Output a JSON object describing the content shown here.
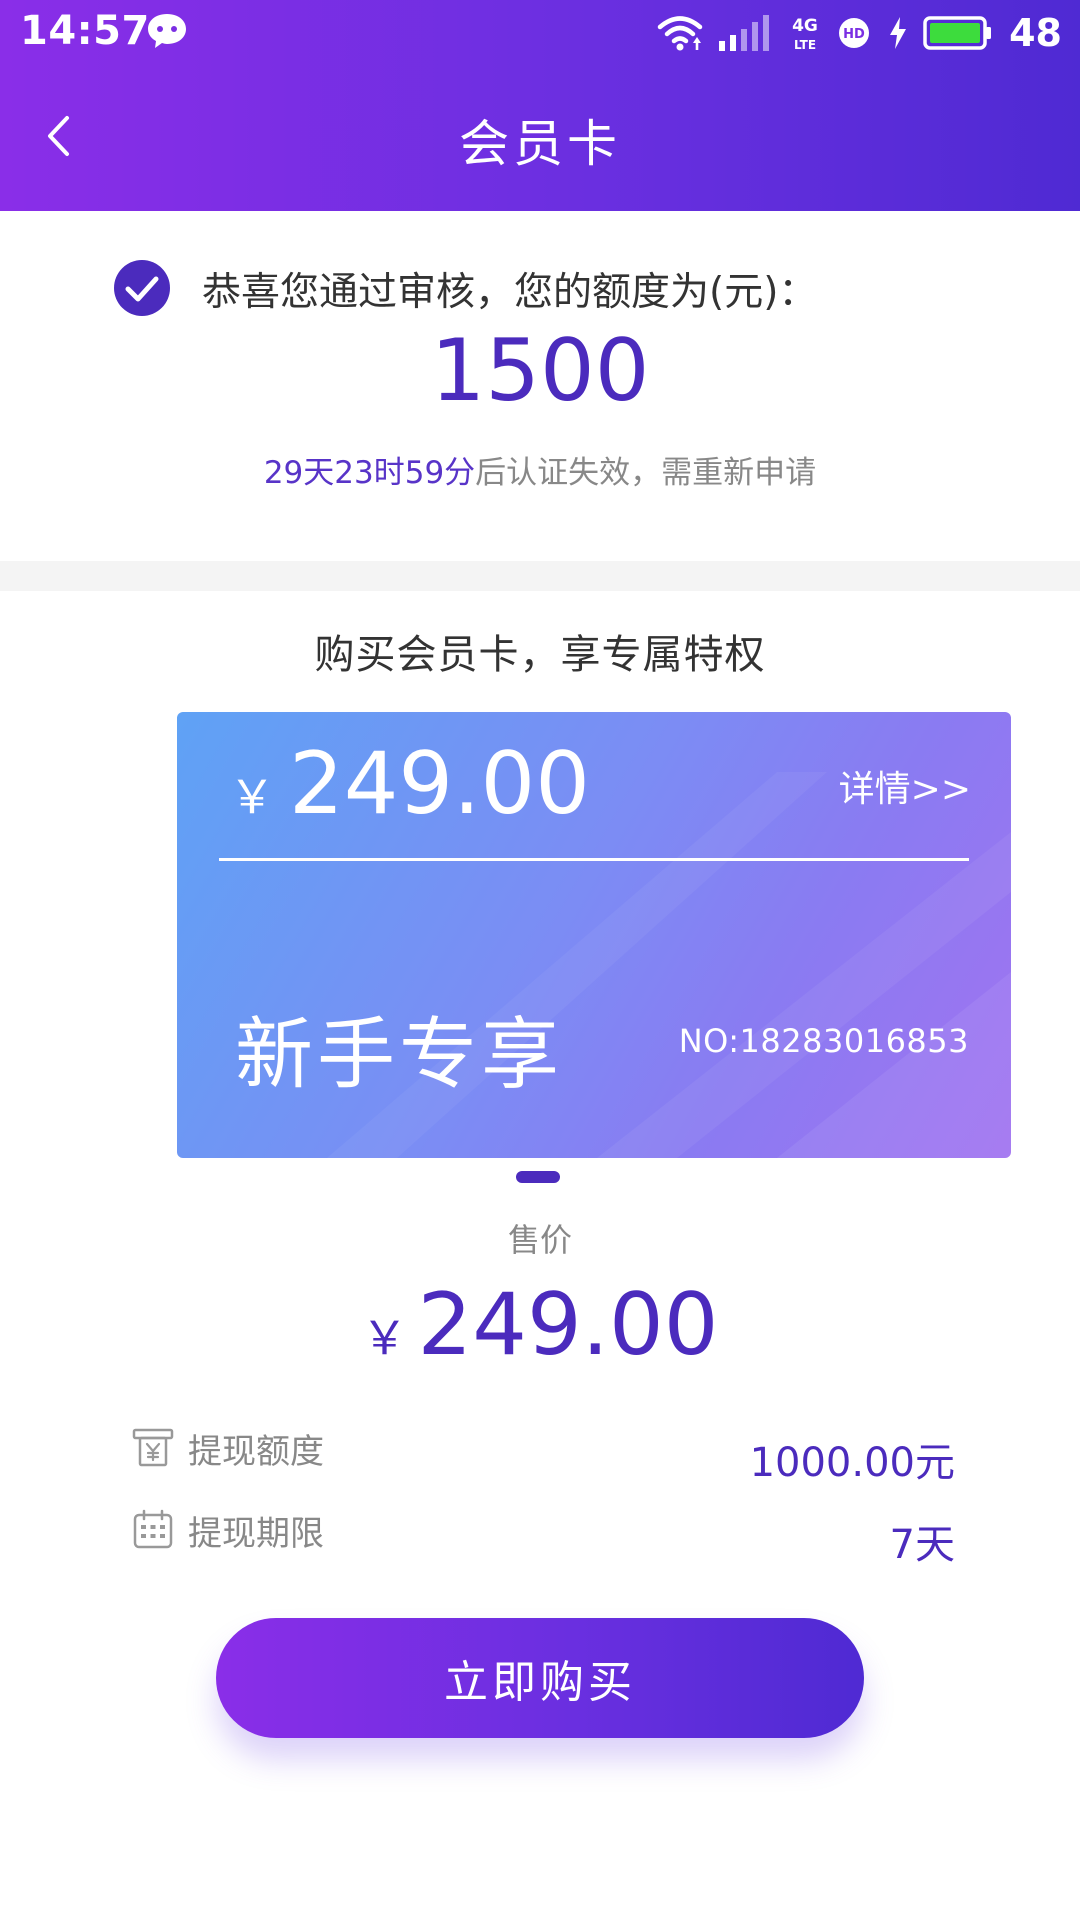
{
  "status_bar": {
    "time": "14:57",
    "network": "4G",
    "network_sub": "LTE",
    "hd": "HD",
    "battery": "48",
    "icons": [
      "chat-bubble-icon",
      "wifi-icon",
      "signal-icon",
      "hd-icon",
      "charging-icon",
      "battery-icon"
    ]
  },
  "header": {
    "title": "会员卡",
    "back_icon": "chevron-left-icon"
  },
  "approval": {
    "message": "恭喜您通过审核，您的额度为(元)：",
    "amount": "1500",
    "countdown": "29天23时59分",
    "expire_suffix": "后认证失效，需重新申请"
  },
  "purchase": {
    "title": "购买会员卡，享专属特权",
    "card": {
      "currency": "￥",
      "price": "249.00",
      "detail_link": "详情>>",
      "label": "新手专享",
      "number": "NO:18283016853"
    },
    "sale_label": "售价",
    "sale_currency": "￥",
    "sale_price": "249.00",
    "rows": [
      {
        "label": "提现额度",
        "value": "1000.00元",
        "icon": "atm-yen-icon"
      },
      {
        "label": "提现期限",
        "value": "7天",
        "icon": "calendar-icon"
      }
    ],
    "buy_button": "立即购买"
  },
  "colors": {
    "primary": "#4b2bbd",
    "gradient_start": "#8a2ee8",
    "gradient_end": "#4f2ad3",
    "card_start": "#5fa2f5",
    "card_end": "#a173f0"
  }
}
